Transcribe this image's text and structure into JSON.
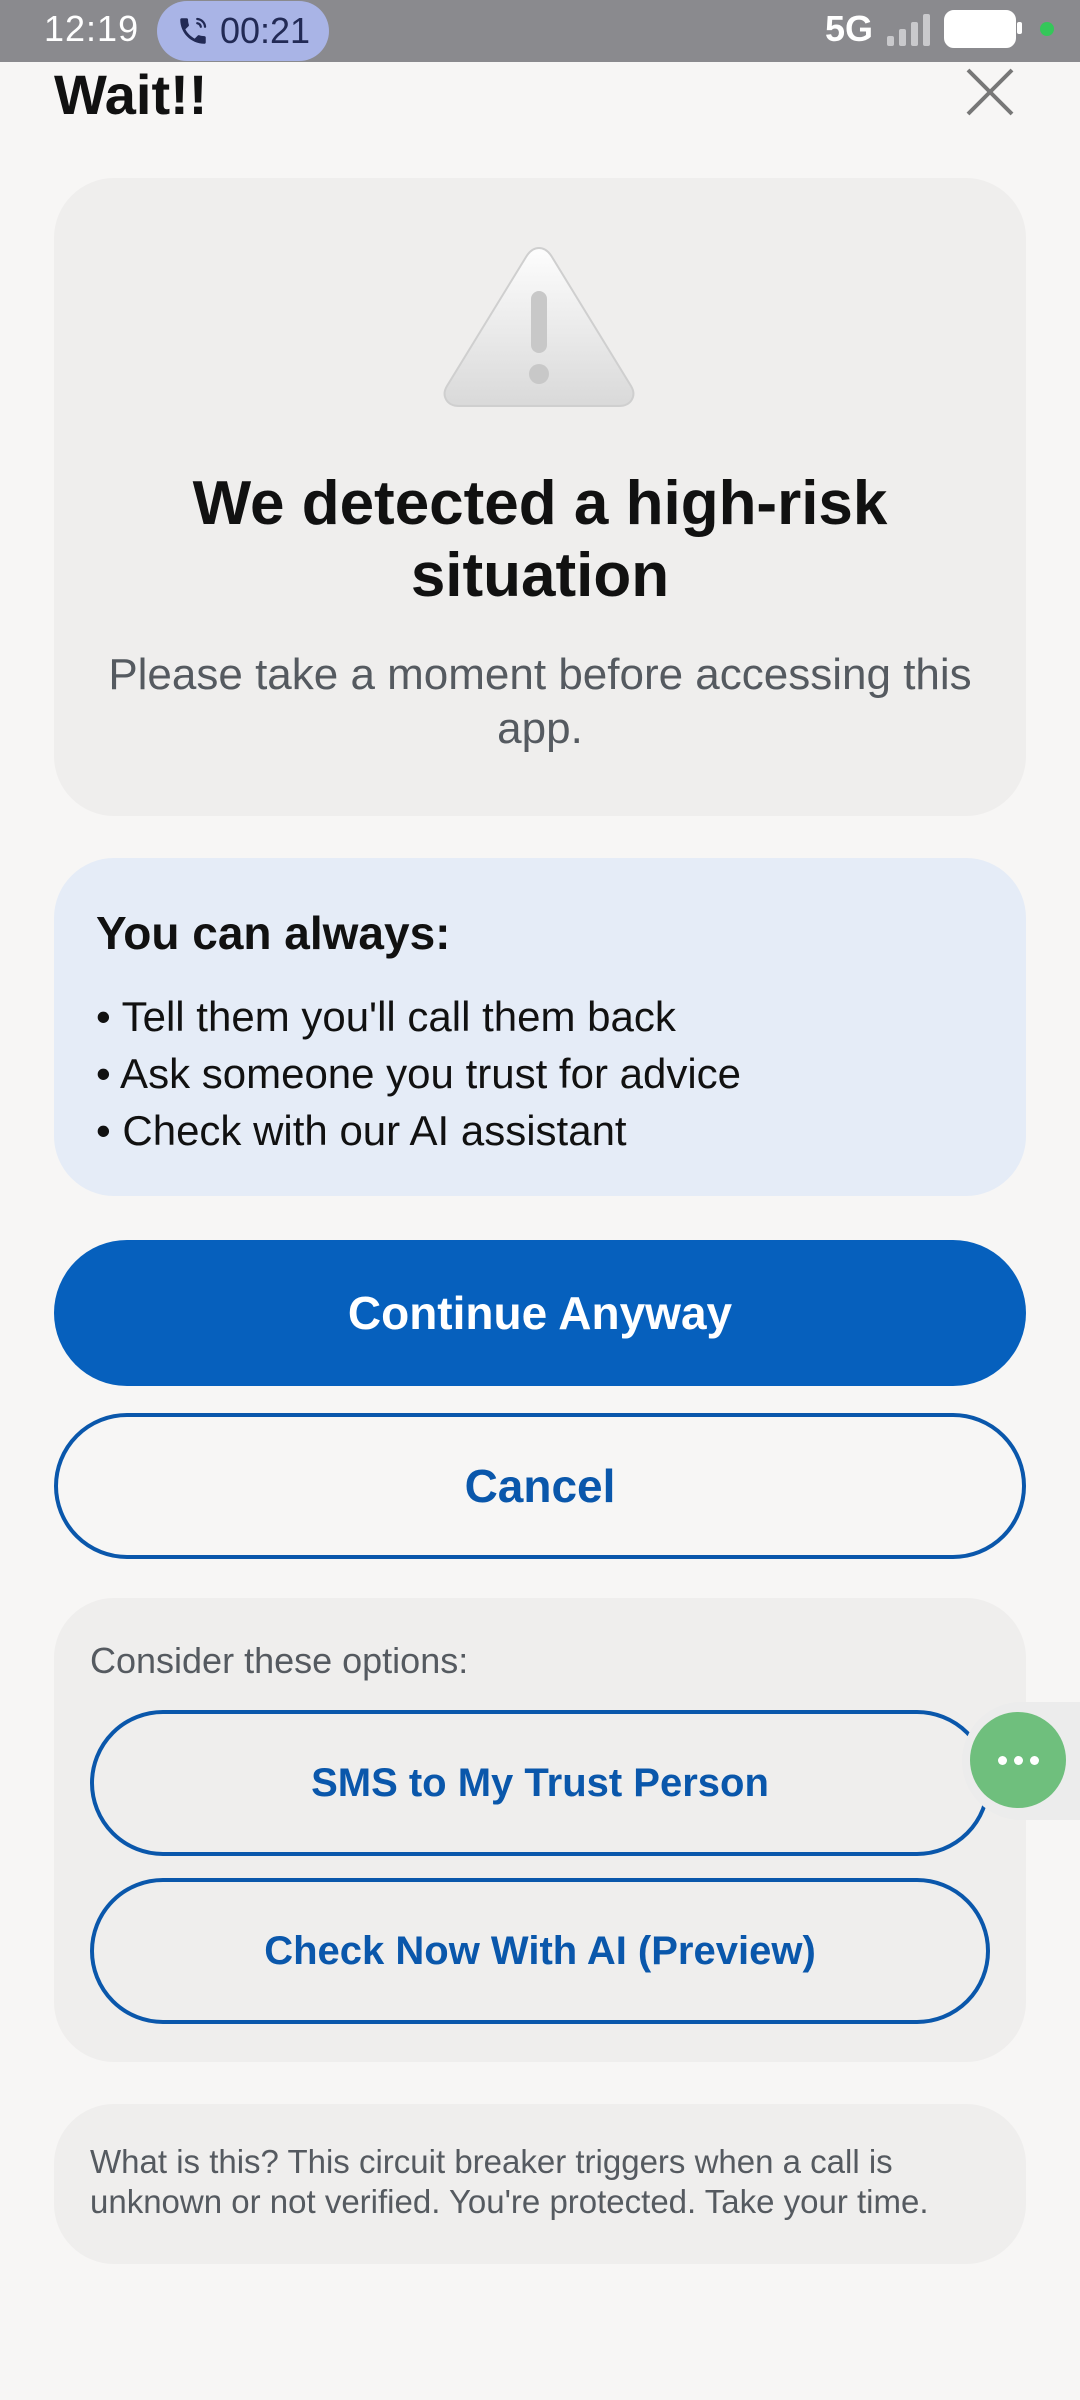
{
  "status_bar": {
    "time": "12:19",
    "call_duration": "00:21",
    "network": "5G",
    "call_icon": "phone-call-icon",
    "signal_icon": "signal-bars-icon",
    "battery_icon": "battery-icon"
  },
  "header": {
    "title": "Wait!!",
    "close_icon": "close-icon"
  },
  "risk_card": {
    "icon": "warning-triangle-icon",
    "heading": "We detected a high-risk situation",
    "subtext": "Please take a moment before accessing this app."
  },
  "always_card": {
    "title": "You can always:",
    "items": [
      "• Tell them you'll call them back",
      "• Ask someone you trust for advice",
      "• Check with our AI assistant"
    ]
  },
  "actions": {
    "continue_label": "Continue Anyway",
    "cancel_label": "Cancel"
  },
  "options_card": {
    "label": "Consider these options:",
    "sms_label": "SMS to My Trust Person",
    "ai_label": "Check Now With AI (Preview)"
  },
  "floating_button": {
    "icon": "more-dots-icon"
  },
  "info_card": {
    "text": "What is this? This circuit breaker triggers when a call is unknown or not verified. You're protected. Take your time."
  },
  "colors": {
    "primary": "#0660bd",
    "primary_outline": "#0a57ab",
    "card_gray": "#efeeed",
    "card_blue": "#e5ecf7",
    "floating_green": "#6fbf7d"
  }
}
